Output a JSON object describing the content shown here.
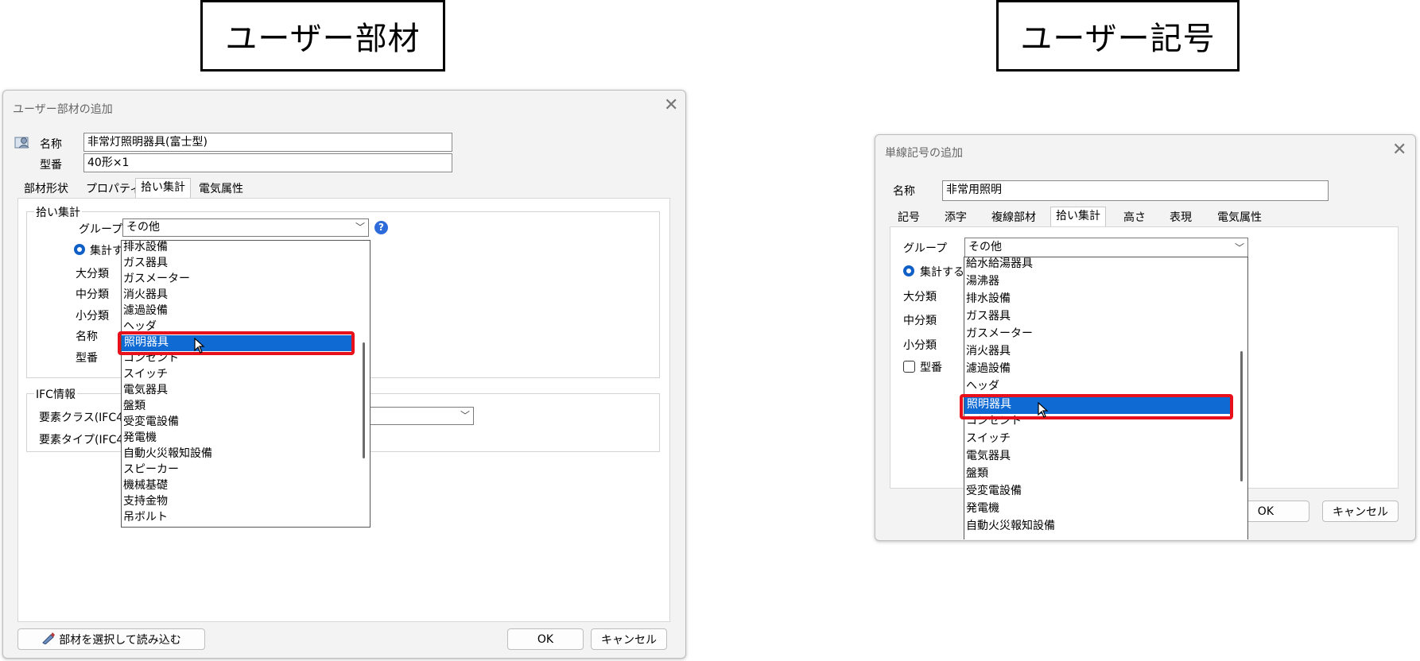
{
  "captions": {
    "left": "ユーザー部材",
    "right": "ユーザー記号"
  },
  "left_dialog": {
    "title": "ユーザー部材の追加",
    "name_label": "名称",
    "name_value": "非常灯照明器具(富士型)",
    "model_label": "型番",
    "model_value": "40形×1",
    "tabs": [
      "部材形状",
      "プロパティ",
      "拾い集計",
      "電気属性"
    ],
    "section_title": "拾い集計",
    "group_label": "グループ",
    "group_value": "その他",
    "aggregate_label": "集計す",
    "rows": [
      "大分類",
      "中分類",
      "小分類",
      "名称",
      "型番"
    ],
    "dropdown_items": [
      "排水設備",
      "ガス器具",
      "ガスメーター",
      "消火器具",
      "濾過設備",
      "ヘッダ",
      "照明器具",
      "コンセント",
      "スイッチ",
      "電気器具",
      "盤類",
      "受変電設備",
      "発電機",
      "自動火災報知設備",
      "スピーカー",
      "機械基礎",
      "支持金物",
      "吊ボルト"
    ],
    "selected_item": "照明器具",
    "ifc_title": "IFC情報",
    "ifc_class_label": "要素クラス(IFC4",
    "ifc_type_label": "要素タイプ(IFC4",
    "load_button": "部材を選択して読み込む",
    "ok": "OK",
    "cancel": "キャンセル"
  },
  "right_dialog": {
    "title": "単線記号の追加",
    "name_label": "名称",
    "name_value": "非常用照明",
    "tabs": [
      "記号",
      "添字",
      "複線部材",
      "拾い集計",
      "高さ",
      "表現",
      "電気属性"
    ],
    "group_label": "グループ",
    "group_value": "その他",
    "aggregate_label": "集計する",
    "rows": [
      "大分類",
      "中分類",
      "小分類"
    ],
    "model_label": "型番",
    "dropdown_items": [
      "給水給湯器具",
      "湯沸器",
      "排水設備",
      "ガス器具",
      "ガスメーター",
      "消火器具",
      "濾過設備",
      "ヘッダ",
      "照明器具",
      "コンセント",
      "スイッチ",
      "電気器具",
      "盤類",
      "受変電設備",
      "発電機",
      "自動火災報知設備"
    ],
    "selected_item": "照明器具",
    "ok": "OK",
    "cancel": "キャンセル"
  },
  "colors": {
    "selection": "#0f6bd3",
    "highlight": "#e8101a",
    "radio": "#0f5fc7",
    "help": "#2d6bdb"
  },
  "icons": [
    "user-member-icon",
    "close-icon",
    "help-icon",
    "chevron-down-icon",
    "pointer-cursor-icon",
    "pick-member-icon"
  ]
}
